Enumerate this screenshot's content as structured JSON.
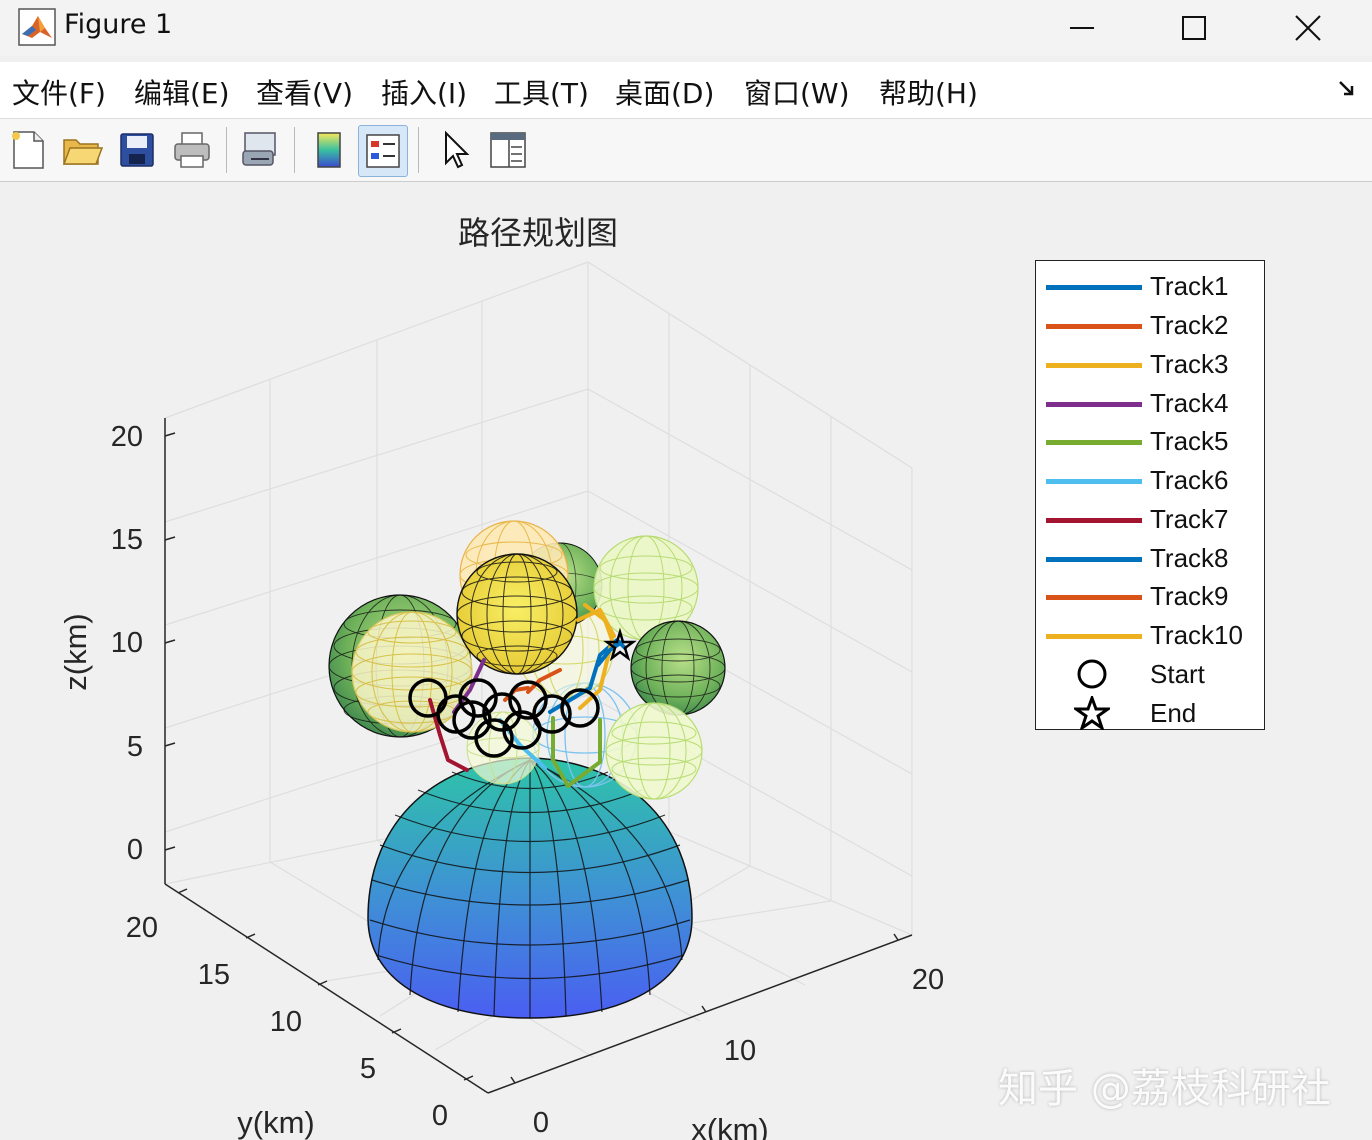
{
  "window": {
    "title": "Figure 1"
  },
  "menu": {
    "items": [
      "文件(F)",
      "编辑(E)",
      "查看(V)",
      "插入(I)",
      "工具(T)",
      "桌面(D)",
      "窗口(W)",
      "帮助(H)"
    ]
  },
  "toolbar": {
    "icons": [
      "new-figure-icon",
      "open-file-icon",
      "save-icon",
      "print-icon",
      "link-icon",
      "colorbar-icon",
      "legend-icon",
      "pointer-icon",
      "property-editor-icon"
    ]
  },
  "chart_data": {
    "type": "3d-line",
    "title": "路径规划图",
    "xlabel": "x(km)",
    "ylabel": "y(km)",
    "zlabel": "z(km)",
    "xlim": [
      0,
      20
    ],
    "ylim": [
      0,
      20
    ],
    "zlim": [
      0,
      20
    ],
    "xticks": [
      "0",
      "10",
      "20"
    ],
    "yticks": [
      "0",
      "5",
      "10",
      "15",
      "20"
    ],
    "zticks": [
      "0",
      "5",
      "10",
      "15",
      "20"
    ],
    "grid": true,
    "legend_position": "right",
    "colors": {
      "grid": "#dedede",
      "box": "#262626",
      "panel": "#ffffff"
    },
    "legend": [
      {
        "label": "Track1",
        "color": "#0072bd",
        "kind": "line"
      },
      {
        "label": "Track2",
        "color": "#d95319",
        "kind": "line"
      },
      {
        "label": "Track3",
        "color": "#edb120",
        "kind": "line"
      },
      {
        "label": "Track4",
        "color": "#7e2f8e",
        "kind": "line"
      },
      {
        "label": "Track5",
        "color": "#77ac30",
        "kind": "line"
      },
      {
        "label": "Track6",
        "color": "#4dbeee",
        "kind": "line"
      },
      {
        "label": "Track7",
        "color": "#a2142f",
        "kind": "line"
      },
      {
        "label": "Track8",
        "color": "#0072bd",
        "kind": "line"
      },
      {
        "label": "Track9",
        "color": "#d95319",
        "kind": "line"
      },
      {
        "label": "Track10",
        "color": "#edb120",
        "kind": "line"
      },
      {
        "label": "Start",
        "color": "#000000",
        "kind": "circle"
      },
      {
        "label": "End",
        "color": "#000000",
        "kind": "star"
      }
    ],
    "obstacles": [
      {
        "name": "hemisphere",
        "kind": "hemisphere",
        "cx": 10,
        "cy": 10,
        "cz": 0,
        "r": 6,
        "colormap": "winter"
      },
      {
        "name": "sphere-left-dark",
        "kind": "sphere",
        "colormap": "summer"
      },
      {
        "name": "sphere-left-light",
        "kind": "sphere",
        "colormap": "wireframe-yellow"
      },
      {
        "name": "sphere-top-orange",
        "kind": "sphere",
        "colormap": "wireframe-orange"
      },
      {
        "name": "sphere-top-yellow",
        "kind": "sphere",
        "colormap": "yellow"
      },
      {
        "name": "sphere-top-right",
        "kind": "sphere",
        "colormap": "wireframe-green"
      },
      {
        "name": "sphere-right-dark",
        "kind": "sphere",
        "colormap": "summer"
      },
      {
        "name": "sphere-right-low",
        "kind": "sphere",
        "colormap": "wireframe-green"
      },
      {
        "name": "sphere-middle",
        "kind": "sphere",
        "colormap": "wireframe-yellow"
      },
      {
        "name": "sphere-blue-wire",
        "kind": "sphere",
        "colormap": "wireframe-blue"
      }
    ]
  },
  "watermark": "知乎 @荔枝科研社"
}
